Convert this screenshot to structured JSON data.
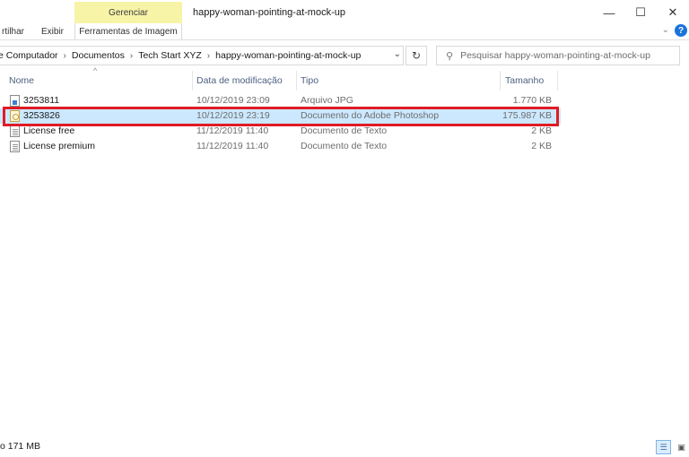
{
  "window": {
    "title": "happy-woman-pointing-at-mock-up",
    "context_tab": "Gerenciar",
    "minimize": "—",
    "maximize": "☐",
    "close": "✕"
  },
  "ribbon": {
    "tabs": [
      "rtilhar",
      "Exibir",
      "Ferramentas de Imagem"
    ],
    "expand_icon": "chevron-down-icon",
    "help": "?"
  },
  "address": {
    "breadcrumbs": [
      "e Computador",
      "Documentos",
      "Tech Start XYZ",
      "happy-woman-pointing-at-mock-up"
    ],
    "separator": "›",
    "dropdown": "⌄",
    "refresh": "↻"
  },
  "search": {
    "placeholder": "Pesquisar happy-woman-pointing-at-mock-up"
  },
  "columns": {
    "name": "Nome",
    "date": "Data de modificação",
    "type": "Tipo",
    "size": "Tamanho",
    "sort_indicator": "^"
  },
  "files": [
    {
      "name": "3253811",
      "date": "10/12/2019 23:09",
      "type": "Arquivo JPG",
      "size": "1.770 KB",
      "icon": "image-file-icon",
      "selected": false
    },
    {
      "name": "3253826",
      "date": "10/12/2019 23:19",
      "type": "Documento do Adobe Photoshop",
      "size": "175.987 KB",
      "icon": "psd-file-icon",
      "selected": true
    },
    {
      "name": "License free",
      "date": "11/12/2019 11:40",
      "type": "Documento de Texto",
      "size": "2 KB",
      "icon": "text-file-icon",
      "selected": false
    },
    {
      "name": "License premium",
      "date": "11/12/2019 11:40",
      "type": "Documento de Texto",
      "size": "2 KB",
      "icon": "text-file-icon",
      "selected": false
    }
  ],
  "status": {
    "text": "o 171 MB"
  },
  "colors": {
    "selection": "#cce8ff",
    "highlight_border": "#e01b24",
    "context_tab_bg": "#f7f4a8",
    "header_text": "#4d6082"
  }
}
